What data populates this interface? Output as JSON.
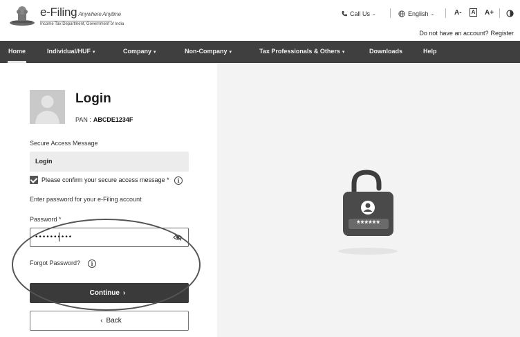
{
  "header": {
    "brand_title": "e-Filing",
    "brand_tagline": "Anywhere Anytime",
    "brand_subtitle": "Income Tax Department, Government of India",
    "call_us": "Call Us",
    "language": "English",
    "font_decrease": "A-",
    "font_reset": "A",
    "font_increase": "A+",
    "no_account_text": "Do not have an account?",
    "register_link": "Register"
  },
  "nav": {
    "items": [
      {
        "label": "Home",
        "active": true
      },
      {
        "label": "Individual/HUF",
        "dropdown": true
      },
      {
        "label": "Company",
        "dropdown": true
      },
      {
        "label": "Non-Company",
        "dropdown": true
      },
      {
        "label": "Tax Professionals & Others",
        "dropdown": true
      },
      {
        "label": "Downloads"
      },
      {
        "label": "Help"
      }
    ]
  },
  "login": {
    "title": "Login",
    "pan_label": "PAN :",
    "pan_value": "ABCDE1234F",
    "secure_access_label": "Secure Access Message",
    "secure_access_value": "Login",
    "confirm_label": "Please confirm your secure access message *",
    "confirm_checked": true,
    "enter_password_text": "Enter password for your e-Filing account",
    "password_label": "Password *",
    "password_value": "••••••••••",
    "forgot_password": "Forgot Password?",
    "continue_label": "Continue",
    "back_label": "Back"
  },
  "illustration": {
    "masked_text": "******"
  },
  "colors": {
    "nav_bg": "#3f3f3f",
    "button_dark": "#3a3a3a",
    "panel_right": "#f3f3f3"
  }
}
